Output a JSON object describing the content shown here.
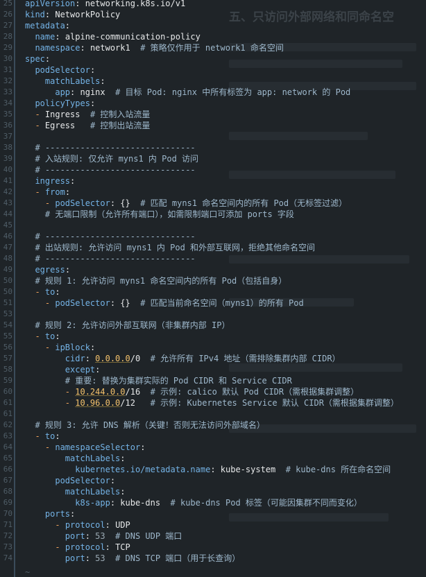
{
  "editor": {
    "theme": {
      "background": "#1f2428",
      "key": "#74b3e6",
      "comment": "#9eb8cc",
      "dash": "#f0a35c",
      "ip": "#f5c26b",
      "gutter_bar": "#3a4c5a"
    },
    "end_of_buffer": "~",
    "lines": [
      {
        "num": "25",
        "tokens": [
          {
            "t": "k",
            "s": "apiVersion"
          },
          {
            "t": "p",
            "s": ": "
          },
          {
            "t": "v",
            "s": "networking.k8s.io/v1"
          }
        ]
      },
      {
        "num": "26",
        "tokens": [
          {
            "t": "k",
            "s": "kind"
          },
          {
            "t": "p",
            "s": ": "
          },
          {
            "t": "v",
            "s": "NetworkPolicy"
          }
        ]
      },
      {
        "num": "27",
        "tokens": [
          {
            "t": "k",
            "s": "metadata"
          },
          {
            "t": "p",
            "s": ":"
          }
        ]
      },
      {
        "num": "28",
        "tokens": [
          {
            "t": "p",
            "s": "  "
          },
          {
            "t": "k",
            "s": "name"
          },
          {
            "t": "p",
            "s": ": "
          },
          {
            "t": "v",
            "s": "alpine-communication-policy"
          }
        ]
      },
      {
        "num": "29",
        "tokens": [
          {
            "t": "p",
            "s": "  "
          },
          {
            "t": "k",
            "s": "namespace"
          },
          {
            "t": "p",
            "s": ": "
          },
          {
            "t": "v",
            "s": "network1  "
          },
          {
            "t": "c",
            "s": "# 策略仅作用于 network1 命名空间"
          }
        ]
      },
      {
        "num": "30",
        "tokens": [
          {
            "t": "k",
            "s": "spec"
          },
          {
            "t": "p",
            "s": ":"
          }
        ]
      },
      {
        "num": "31",
        "tokens": [
          {
            "t": "p",
            "s": "  "
          },
          {
            "t": "k",
            "s": "podSelector"
          },
          {
            "t": "p",
            "s": ":"
          }
        ]
      },
      {
        "num": "32",
        "tokens": [
          {
            "t": "p",
            "s": "    "
          },
          {
            "t": "k",
            "s": "matchLabels"
          },
          {
            "t": "p",
            "s": ":"
          }
        ]
      },
      {
        "num": "33",
        "tokens": [
          {
            "t": "p",
            "s": "      "
          },
          {
            "t": "k",
            "s": "app"
          },
          {
            "t": "p",
            "s": ": "
          },
          {
            "t": "v",
            "s": "nginx  "
          },
          {
            "t": "c",
            "s": "# 目标 Pod: nginx 中所有标签为 app: network 的 Pod"
          }
        ]
      },
      {
        "num": "34",
        "hl": true,
        "tokens": [
          {
            "t": "p",
            "s": "  "
          },
          {
            "t": "k",
            "s": "policyTypes"
          },
          {
            "t": "p",
            "s": ":"
          }
        ]
      },
      {
        "num": "35",
        "tokens": [
          {
            "t": "p",
            "s": "  "
          },
          {
            "t": "d",
            "s": "- "
          },
          {
            "t": "v",
            "s": "Ingress  "
          },
          {
            "t": "c",
            "s": "# 控制入站流量"
          }
        ]
      },
      {
        "num": "36",
        "tokens": [
          {
            "t": "p",
            "s": "  "
          },
          {
            "t": "d",
            "s": "- "
          },
          {
            "t": "v",
            "s": "Egress   "
          },
          {
            "t": "c",
            "s": "# 控制出站流量"
          }
        ]
      },
      {
        "num": "37",
        "tokens": []
      },
      {
        "num": "38",
        "tokens": [
          {
            "t": "p",
            "s": "  "
          },
          {
            "t": "c",
            "s": "# ------------------------------"
          }
        ]
      },
      {
        "num": "39",
        "tokens": [
          {
            "t": "p",
            "s": "  "
          },
          {
            "t": "c",
            "s": "# 入站规则: 仅允许 myns1 内 Pod 访问"
          }
        ]
      },
      {
        "num": "40",
        "tokens": [
          {
            "t": "p",
            "s": "  "
          },
          {
            "t": "c",
            "s": "# ------------------------------"
          }
        ]
      },
      {
        "num": "41",
        "tokens": [
          {
            "t": "p",
            "s": "  "
          },
          {
            "t": "k",
            "s": "ingress"
          },
          {
            "t": "p",
            "s": ":"
          }
        ]
      },
      {
        "num": "42",
        "tokens": [
          {
            "t": "p",
            "s": "  "
          },
          {
            "t": "d",
            "s": "- "
          },
          {
            "t": "k",
            "s": "from"
          },
          {
            "t": "p",
            "s": ":"
          }
        ]
      },
      {
        "num": "43",
        "tokens": [
          {
            "t": "p",
            "s": "    "
          },
          {
            "t": "d",
            "s": "- "
          },
          {
            "t": "k",
            "s": "podSelector"
          },
          {
            "t": "p",
            "s": ": {}  "
          },
          {
            "t": "c",
            "s": "# 匹配 myns1 命名空间内的所有 Pod（无标签过滤）"
          }
        ]
      },
      {
        "num": "44",
        "tokens": [
          {
            "t": "p",
            "s": "    "
          },
          {
            "t": "c",
            "s": "# 无端口限制（允许所有端口），如需限制端口可添加 ports 字段"
          }
        ]
      },
      {
        "num": "45",
        "tokens": []
      },
      {
        "num": "46",
        "tokens": [
          {
            "t": "p",
            "s": "  "
          },
          {
            "t": "c",
            "s": "# ------------------------------"
          }
        ]
      },
      {
        "num": "47",
        "tokens": [
          {
            "t": "p",
            "s": "  "
          },
          {
            "t": "c",
            "s": "# 出站规则: 允许访问 myns1 内 Pod 和外部互联网，拒绝其他命名空间"
          }
        ]
      },
      {
        "num": "48",
        "tokens": [
          {
            "t": "p",
            "s": "  "
          },
          {
            "t": "c",
            "s": "# ------------------------------"
          }
        ]
      },
      {
        "num": "49",
        "tokens": [
          {
            "t": "p",
            "s": "  "
          },
          {
            "t": "k",
            "s": "egress"
          },
          {
            "t": "p",
            "s": ":"
          }
        ]
      },
      {
        "num": "50",
        "tokens": [
          {
            "t": "p",
            "s": "  "
          },
          {
            "t": "c",
            "s": "# 规则 1: 允许访问 myns1 命名空间内的所有 Pod（包括自身）"
          }
        ]
      },
      {
        "num": "50",
        "tokens": [
          {
            "t": "p",
            "s": "  "
          },
          {
            "t": "d",
            "s": "- "
          },
          {
            "t": "k",
            "s": "to"
          },
          {
            "t": "p",
            "s": ":"
          }
        ]
      },
      {
        "num": "51",
        "tokens": [
          {
            "t": "p",
            "s": "    "
          },
          {
            "t": "d",
            "s": "- "
          },
          {
            "t": "k",
            "s": "podSelector"
          },
          {
            "t": "p",
            "s": ": {}  "
          },
          {
            "t": "c",
            "s": "# 匹配当前命名空间（myns1）的所有 Pod"
          }
        ]
      },
      {
        "num": "53",
        "tokens": []
      },
      {
        "num": "54",
        "tokens": [
          {
            "t": "p",
            "s": "  "
          },
          {
            "t": "c",
            "s": "# 规则 2: 允许访问外部互联网（非集群内部 IP）"
          }
        ]
      },
      {
        "num": "55",
        "tokens": [
          {
            "t": "p",
            "s": "  "
          },
          {
            "t": "d",
            "s": "- "
          },
          {
            "t": "k",
            "s": "to"
          },
          {
            "t": "p",
            "s": ":"
          }
        ]
      },
      {
        "num": "56",
        "tokens": [
          {
            "t": "p",
            "s": "    "
          },
          {
            "t": "d",
            "s": "- "
          },
          {
            "t": "k",
            "s": "ipBlock"
          },
          {
            "t": "p",
            "s": ":"
          }
        ]
      },
      {
        "num": "57",
        "tokens": [
          {
            "t": "p",
            "s": "        "
          },
          {
            "t": "k",
            "s": "cidr"
          },
          {
            "t": "p",
            "s": ": "
          },
          {
            "t": "ip",
            "s": "0.0.0.0"
          },
          {
            "t": "v",
            "s": "/0  "
          },
          {
            "t": "c",
            "s": "# 允许所有 IPv4 地址（需排除集群内部 CIDR）"
          }
        ]
      },
      {
        "num": "58",
        "tokens": [
          {
            "t": "p",
            "s": "        "
          },
          {
            "t": "k",
            "s": "except"
          },
          {
            "t": "p",
            "s": ":"
          }
        ]
      },
      {
        "num": "59",
        "tokens": [
          {
            "t": "p",
            "s": "        "
          },
          {
            "t": "c",
            "s": "# 重要: 替换为集群实际的 Pod CIDR 和 Service CIDR"
          }
        ]
      },
      {
        "num": "60",
        "tokens": [
          {
            "t": "p",
            "s": "        "
          },
          {
            "t": "d",
            "s": "- "
          },
          {
            "t": "ip",
            "s": "10.244.0.0"
          },
          {
            "t": "v",
            "s": "/16  "
          },
          {
            "t": "c",
            "s": "# 示例: calico 默认 Pod CIDR（需根据集群调整）"
          }
        ]
      },
      {
        "num": "61",
        "tokens": [
          {
            "t": "p",
            "s": "        "
          },
          {
            "t": "d",
            "s": "- "
          },
          {
            "t": "ip",
            "s": "10.96.0.0"
          },
          {
            "t": "v",
            "s": "/12   "
          },
          {
            "t": "c",
            "s": "# 示例: Kubernetes Service 默认 CIDR（需根据集群调整）"
          }
        ]
      },
      {
        "num": "61",
        "tokens": []
      },
      {
        "num": "62",
        "tokens": [
          {
            "t": "p",
            "s": "  "
          },
          {
            "t": "c",
            "s": "# 规则 3: 允许 DNS 解析（关键！否则无法访问外部域名）"
          }
        ]
      },
      {
        "num": "63",
        "tokens": [
          {
            "t": "p",
            "s": "  "
          },
          {
            "t": "d",
            "s": "- "
          },
          {
            "t": "k",
            "s": "to"
          },
          {
            "t": "p",
            "s": ":"
          }
        ]
      },
      {
        "num": "64",
        "tokens": [
          {
            "t": "p",
            "s": "    "
          },
          {
            "t": "d",
            "s": "- "
          },
          {
            "t": "k",
            "s": "namespaceSelector"
          },
          {
            "t": "p",
            "s": ":"
          }
        ]
      },
      {
        "num": "65",
        "tokens": [
          {
            "t": "p",
            "s": "        "
          },
          {
            "t": "k",
            "s": "matchLabels"
          },
          {
            "t": "p",
            "s": ":"
          }
        ]
      },
      {
        "num": "66",
        "tokens": [
          {
            "t": "p",
            "s": "          "
          },
          {
            "t": "k",
            "s": "kubernetes.io/metadata.name"
          },
          {
            "t": "p",
            "s": ": "
          },
          {
            "t": "v",
            "s": "kube-system  "
          },
          {
            "t": "c",
            "s": "# kube-dns 所在命名空间"
          }
        ]
      },
      {
        "num": "67",
        "tokens": [
          {
            "t": "p",
            "s": "      "
          },
          {
            "t": "k",
            "s": "podSelector"
          },
          {
            "t": "p",
            "s": ":"
          }
        ]
      },
      {
        "num": "68",
        "tokens": [
          {
            "t": "p",
            "s": "        "
          },
          {
            "t": "k",
            "s": "matchLabels"
          },
          {
            "t": "p",
            "s": ":"
          }
        ]
      },
      {
        "num": "69",
        "tokens": [
          {
            "t": "p",
            "s": "          "
          },
          {
            "t": "k",
            "s": "k8s-app"
          },
          {
            "t": "p",
            "s": ": "
          },
          {
            "t": "v",
            "s": "kube-dns  "
          },
          {
            "t": "c",
            "s": "# kube-dns Pod 标签（可能因集群不同而变化）"
          }
        ]
      },
      {
        "num": "70",
        "tokens": [
          {
            "t": "p",
            "s": "    "
          },
          {
            "t": "k",
            "s": "ports"
          },
          {
            "t": "p",
            "s": ":"
          }
        ]
      },
      {
        "num": "71",
        "tokens": [
          {
            "t": "p",
            "s": "      "
          },
          {
            "t": "d",
            "s": "- "
          },
          {
            "t": "k",
            "s": "protocol"
          },
          {
            "t": "p",
            "s": ": "
          },
          {
            "t": "v",
            "s": "UDP"
          }
        ]
      },
      {
        "num": "72",
        "tokens": [
          {
            "t": "p",
            "s": "        "
          },
          {
            "t": "k",
            "s": "port"
          },
          {
            "t": "p",
            "s": ": "
          },
          {
            "t": "n",
            "s": "53  "
          },
          {
            "t": "c",
            "s": "# DNS UDP 端口"
          }
        ]
      },
      {
        "num": "73",
        "tokens": [
          {
            "t": "p",
            "s": "      "
          },
          {
            "t": "d",
            "s": "- "
          },
          {
            "t": "k",
            "s": "protocol"
          },
          {
            "t": "p",
            "s": ": "
          },
          {
            "t": "v",
            "s": "TCP"
          }
        ]
      },
      {
        "num": "74",
        "tokens": [
          {
            "t": "p",
            "s": "        "
          },
          {
            "t": "k",
            "s": "port"
          },
          {
            "t": "p",
            "s": ": "
          },
          {
            "t": "n",
            "s": "53  "
          },
          {
            "t": "c",
            "s": "# DNS TCP 端口（用于长查询）"
          }
        ]
      }
    ]
  },
  "background_doc": {
    "title": "五、只访问外部网络和同命名空"
  }
}
